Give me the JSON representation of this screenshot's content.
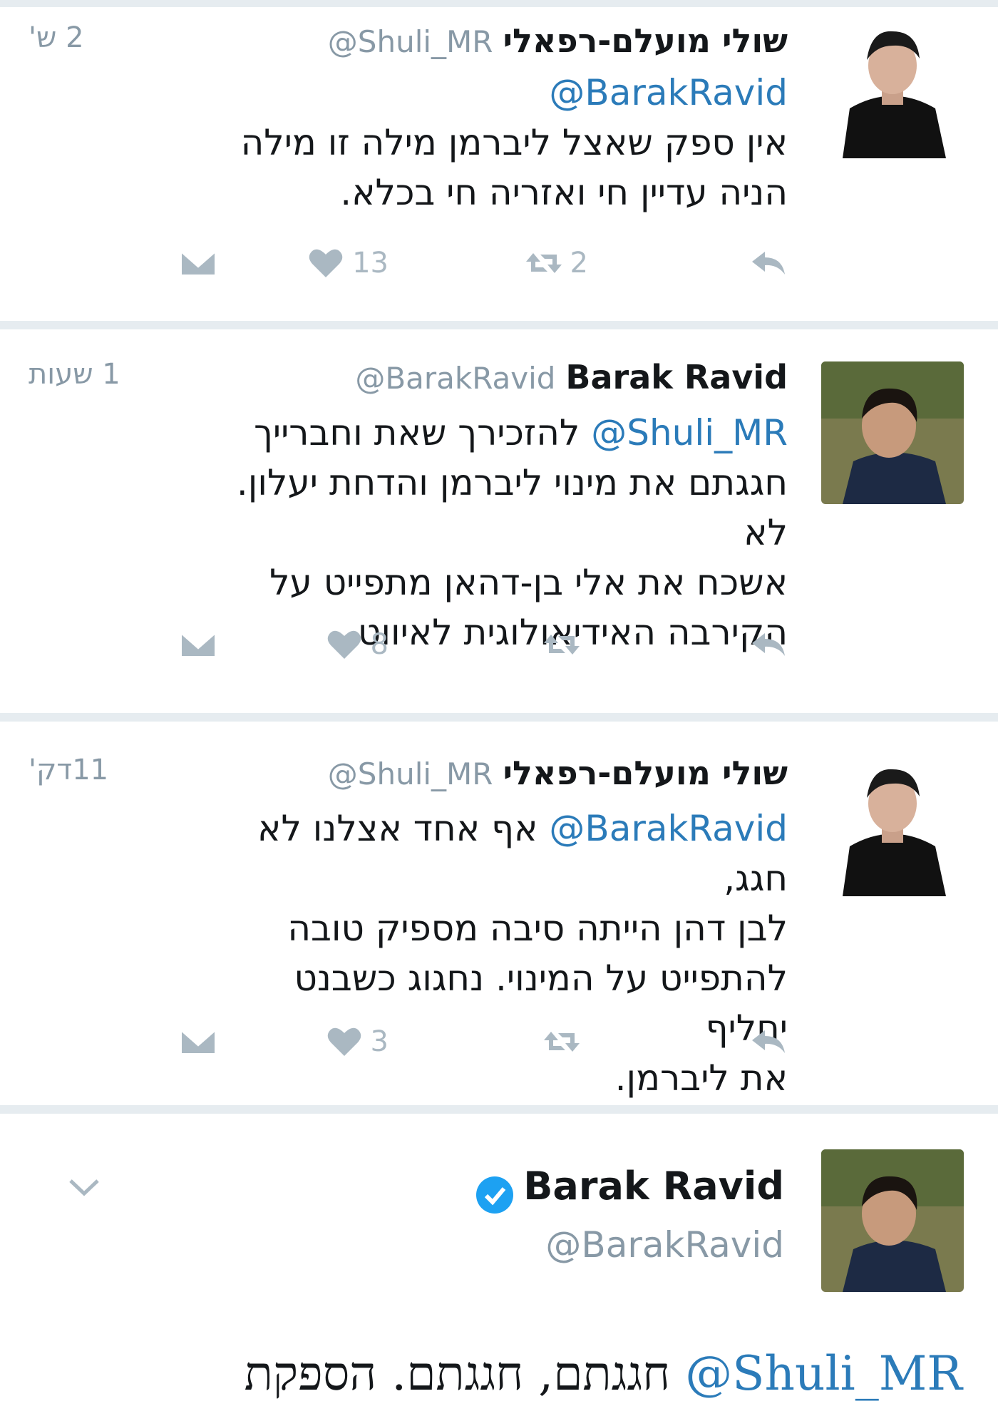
{
  "tweets": [
    {
      "name": "שולי מועלם-רפאלי",
      "handle": "@Shuli_MR",
      "time": "2 ש'",
      "mention": "@BarakRavid",
      "text_line1": "אין ספק שאצל ליברמן מילה זו מילה",
      "text_line2": "הניה עדיין חי ואזריה חי בכלא.",
      "replies": "",
      "retweets": "2",
      "likes": "13"
    },
    {
      "name": "Barak Ravid",
      "handle": "@BarakRavid",
      "time": "1 שעות",
      "mention": "@Shuli_MR",
      "text_line1": "להזכירך שאת וחברייך",
      "text_line2": "חגגתם את מינוי ליברמן והדחת יעלון. לא",
      "text_line3": "אשכח את אלי בן-דהאן מתפייט על",
      "text_line4": "הקירבה האידיאולוגית לאיווט",
      "retweets": "",
      "likes": "8"
    },
    {
      "name": "שולי מועלם-רפאלי",
      "handle": "@Shuli_MR",
      "time": "11דק'",
      "mention": "@BarakRavid",
      "text_line1": "אף אחד אצלנו לא חגג,",
      "text_line2": "לבן דהן הייתה סיבה מספיק טובה",
      "text_line3": "להתפייט על המינוי. נחגוג כשבנט יחליף",
      "text_line4": "את ליברמן.",
      "retweets": "",
      "likes": "3"
    }
  ],
  "focused": {
    "name": "Barak Ravid",
    "handle": "@BarakRavid",
    "mention": "@Shuli_MR",
    "text": "חגגתם, חגגתם. הספקת"
  },
  "colors": {
    "link": "#2b7bb9",
    "muted": "#8899a6",
    "icon": "#aab8c2",
    "verified": "#1da1f2",
    "separator": "#e6ecf0"
  }
}
